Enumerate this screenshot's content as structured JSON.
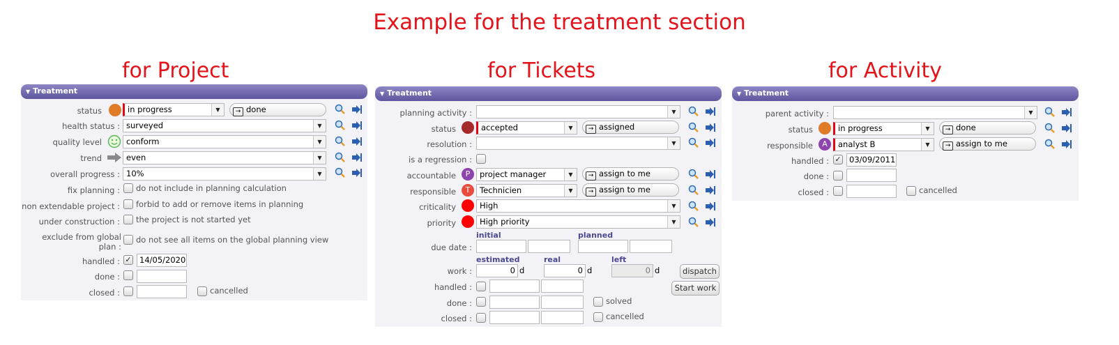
{
  "title": "Example for the treatment section",
  "colors": {
    "accent_red": "#e3141b",
    "header_purple": "#5e579e",
    "status_orange": "#e07b27",
    "status_darkred": "#a52a2a",
    "priority_red": "#ff0000",
    "user_purple": "#8e44ad",
    "user_red": "#e74c3c"
  },
  "project": {
    "heading": "for Project",
    "section_title": "Treatment",
    "labels": {
      "status": "status",
      "health_status": "health status :",
      "quality_level": "quality level",
      "trend": "trend",
      "overall_progress": "overall progress :",
      "fix_planning": "fix planning :",
      "non_extendable": "non extendable project :",
      "under_construction": "under construction :",
      "exclude_global_1": "exclude from global",
      "exclude_global_2": "plan :",
      "handled": "handled :",
      "done": "done :",
      "closed": "closed :"
    },
    "values": {
      "status": "in progress",
      "status_next": "done",
      "health_status": "surveyed",
      "quality_level": "conform",
      "trend": "even",
      "overall_progress": "10%",
      "handled_date": "14/05/2020",
      "handled_check": "✓"
    },
    "checkbox_texts": {
      "fix_planning": "do not include in planning calculation",
      "non_extendable": "forbid to add or remove items in planning",
      "under_construction": "the project is not started yet",
      "exclude_global": "do not see all items on the global planning view",
      "cancelled": "cancelled"
    }
  },
  "tickets": {
    "heading": "for Tickets",
    "section_title": "Treatment",
    "labels": {
      "planning_activity": "planning activity :",
      "status": "status",
      "resolution": "resolution :",
      "is_regression": "is a regression :",
      "accountable": "accountable",
      "responsible": "responsible",
      "criticality": "criticality",
      "priority": "priority",
      "due_date": "due date :",
      "work": "work :",
      "handled": "handled :",
      "done": "done :",
      "closed": "closed :"
    },
    "values": {
      "status": "accepted",
      "status_next": "assigned",
      "accountable": "project manager",
      "accountable_initial": "P",
      "responsible": "Technicien",
      "responsible_initial": "T",
      "assign_to_me": "assign to me",
      "criticality": "High",
      "priority": "High priority",
      "work_estimated": "0",
      "work_real": "0",
      "work_left": "0",
      "unit": "d"
    },
    "headers": {
      "initial": "initial",
      "planned": "planned",
      "estimated": "estimated",
      "real": "real",
      "left": "left"
    },
    "buttons": {
      "dispatch": "dispatch",
      "start_work": "Start work"
    },
    "checkbox_texts": {
      "solved": "solved",
      "cancelled": "cancelled"
    }
  },
  "activity": {
    "heading": "for Activity",
    "section_title": "Treatment",
    "labels": {
      "parent_activity": "parent activity :",
      "status": "status",
      "responsible": "responsible",
      "handled": "handled :",
      "done": "done :",
      "closed": "closed :"
    },
    "values": {
      "status": "in progress",
      "status_next": "done",
      "responsible": "analyst B",
      "responsible_initial": "A",
      "assign_to_me": "assign to me",
      "handled_date": "03/09/2011",
      "handled_check": "✓"
    },
    "checkbox_texts": {
      "cancelled": "cancelled"
    }
  }
}
